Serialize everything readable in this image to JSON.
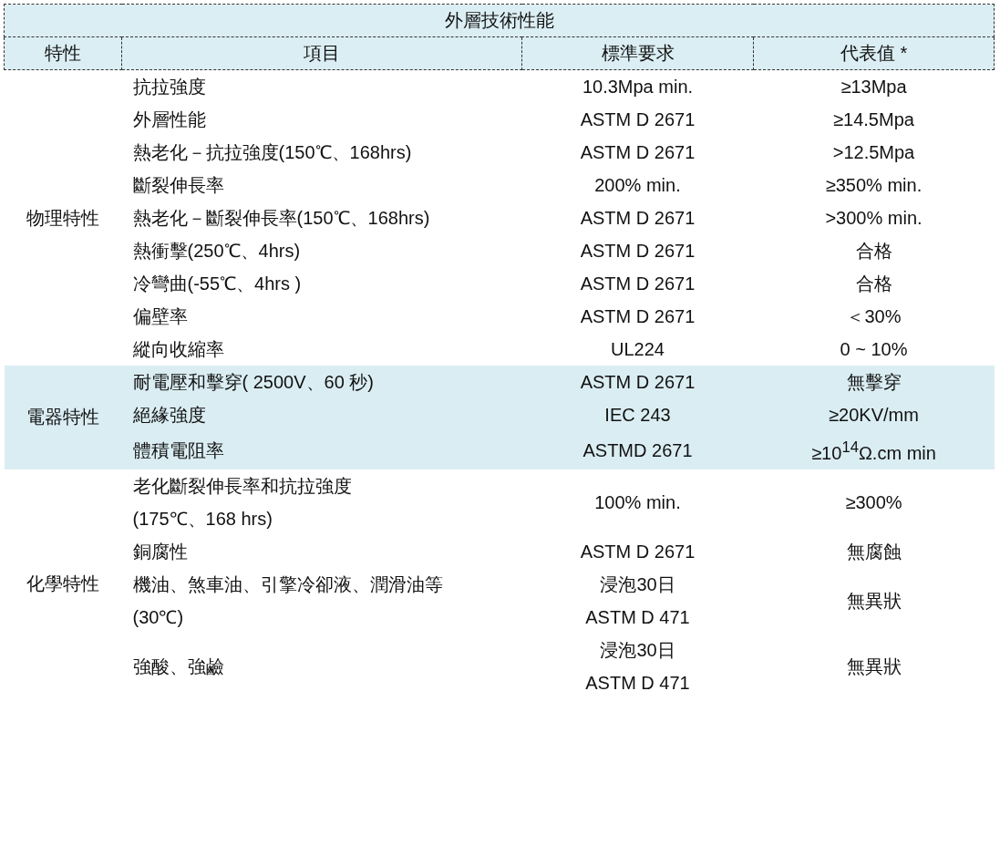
{
  "table": {
    "title": "外層技術性能",
    "columns": [
      "特性",
      "項目",
      "標準要求",
      "代表值 *"
    ],
    "groups": [
      {
        "category": "物理特性",
        "highlighted": false,
        "rows": [
          {
            "item": [
              "抗拉強度"
            ],
            "standard": [
              "10.3Mpa min."
            ],
            "value": "≥13Mpa"
          },
          {
            "item": [
              "外層性能"
            ],
            "standard": [
              "ASTM D 2671"
            ],
            "value": "≥14.5Mpa"
          },
          {
            "item": [
              "熱老化－抗拉強度(150℃、168hrs)"
            ],
            "standard": [
              "ASTM D 2671"
            ],
            "value": ">12.5Mpa"
          },
          {
            "item": [
              "斷裂伸長率"
            ],
            "standard": [
              "200% min."
            ],
            "value": "≥350% min."
          },
          {
            "item": [
              "熱老化－斷裂伸長率(150℃、168hrs)"
            ],
            "standard": [
              "ASTM D 2671"
            ],
            "value": ">300% min."
          },
          {
            "item": [
              "熱衝擊(250℃、4hrs)"
            ],
            "standard": [
              "ASTM D 2671"
            ],
            "value": "合格"
          },
          {
            "item": [
              "冷彎曲(-55℃、4hrs )"
            ],
            "standard": [
              "ASTM D 2671"
            ],
            "value": "合格"
          },
          {
            "item": [
              "偏壁率"
            ],
            "standard": [
              "ASTM D 2671"
            ],
            "value": "＜30%"
          },
          {
            "item": [
              "縱向收縮率"
            ],
            "standard": [
              "UL224"
            ],
            "value": "0 ~ 10%"
          }
        ]
      },
      {
        "category": "電器特性",
        "highlighted": true,
        "rows": [
          {
            "item": [
              "耐電壓和擊穿( 2500V、60  秒)"
            ],
            "standard": [
              "ASTM D 2671"
            ],
            "value": "無擊穿"
          },
          {
            "item": [
              "絕緣強度"
            ],
            "standard": [
              "IEC 243"
            ],
            "value": "≥20KV/mm"
          },
          {
            "item": [
              "體積電阻率"
            ],
            "standard": [
              "ASTMD 2671"
            ],
            "value": "≥10$^{14}$Ω.cm min"
          }
        ]
      },
      {
        "category": "化學特性",
        "highlighted": false,
        "rows": [
          {
            "item": [
              "老化斷裂伸長率和抗拉強度",
              "(175℃、168 hrs)"
            ],
            "standard": [
              "100% min."
            ],
            "value": "≥300%"
          },
          {
            "item": [
              "銅腐性"
            ],
            "standard": [
              "ASTM D 2671"
            ],
            "value": "無腐蝕"
          },
          {
            "item": [
              "機油、煞車油、引擎冷卻液、潤滑油等",
              "(30℃)"
            ],
            "standard": [
              "浸泡30日",
              "ASTM D 471"
            ],
            "value": "無異狀"
          },
          {
            "item": [
              "強酸、強鹼"
            ],
            "standard": [
              "浸泡30日",
              "ASTM D 471"
            ],
            "value": "無異狀"
          }
        ]
      }
    ]
  }
}
